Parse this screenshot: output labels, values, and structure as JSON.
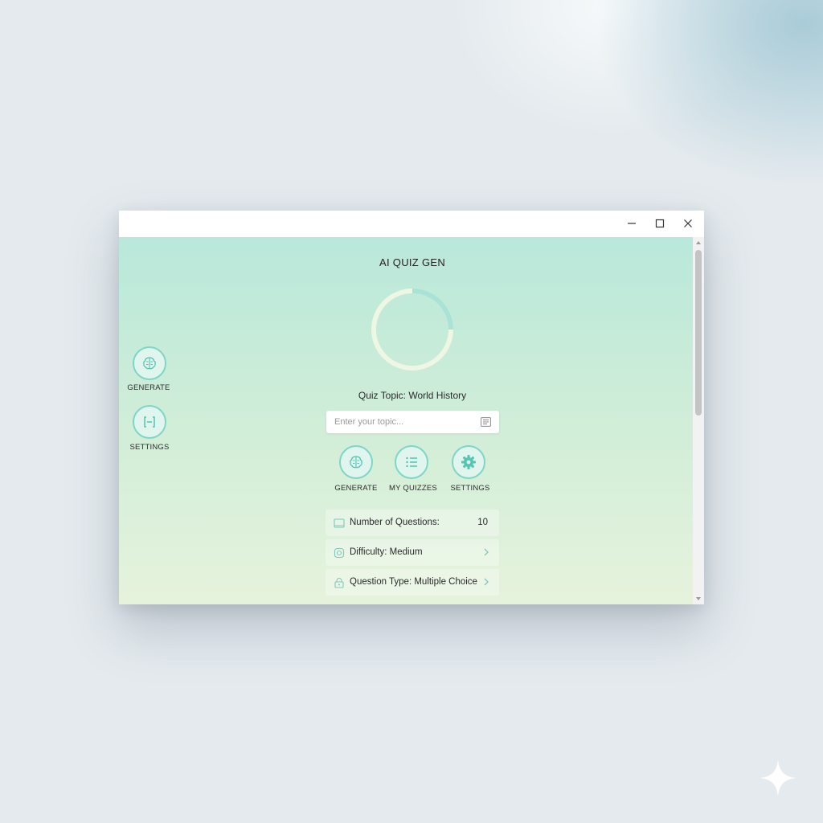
{
  "window": {
    "controls": {
      "minimize": "minimize",
      "maximize": "maximize",
      "close": "close"
    }
  },
  "app": {
    "title": "AI QUIZ GEN",
    "progress_ring": {
      "fraction": 0.25,
      "fill_color": "#a8e3d6",
      "track_color": "#eef6e4"
    }
  },
  "side_nav": {
    "items": [
      {
        "label": "GENERATE",
        "icon": "brain-icon"
      },
      {
        "label": "SETTINGS",
        "icon": "bracket-frame-icon"
      }
    ]
  },
  "topic": {
    "label": "Quiz Topic: World History",
    "placeholder": "Enter your topic..."
  },
  "actions": [
    {
      "label": "GENERATE",
      "icon": "brain-icon"
    },
    {
      "label": "MY QUIZZES",
      "icon": "list-icon"
    },
    {
      "label": "SETTINGS",
      "icon": "gear-icon"
    }
  ],
  "options": {
    "questions": {
      "label": "Number of Questions:",
      "value": "10",
      "icon": "book-icon"
    },
    "difficulty": {
      "label": "Difficulty: Medium",
      "icon": "target-icon"
    },
    "question_type": {
      "label": "Question Type: Multiple Choice",
      "icon": "lock-icon"
    }
  },
  "colors": {
    "accent": "#7fd6c6",
    "accent_fill": "#dff5ee",
    "content_top": "#b9e8da",
    "content_bottom": "#e6f3dc"
  }
}
